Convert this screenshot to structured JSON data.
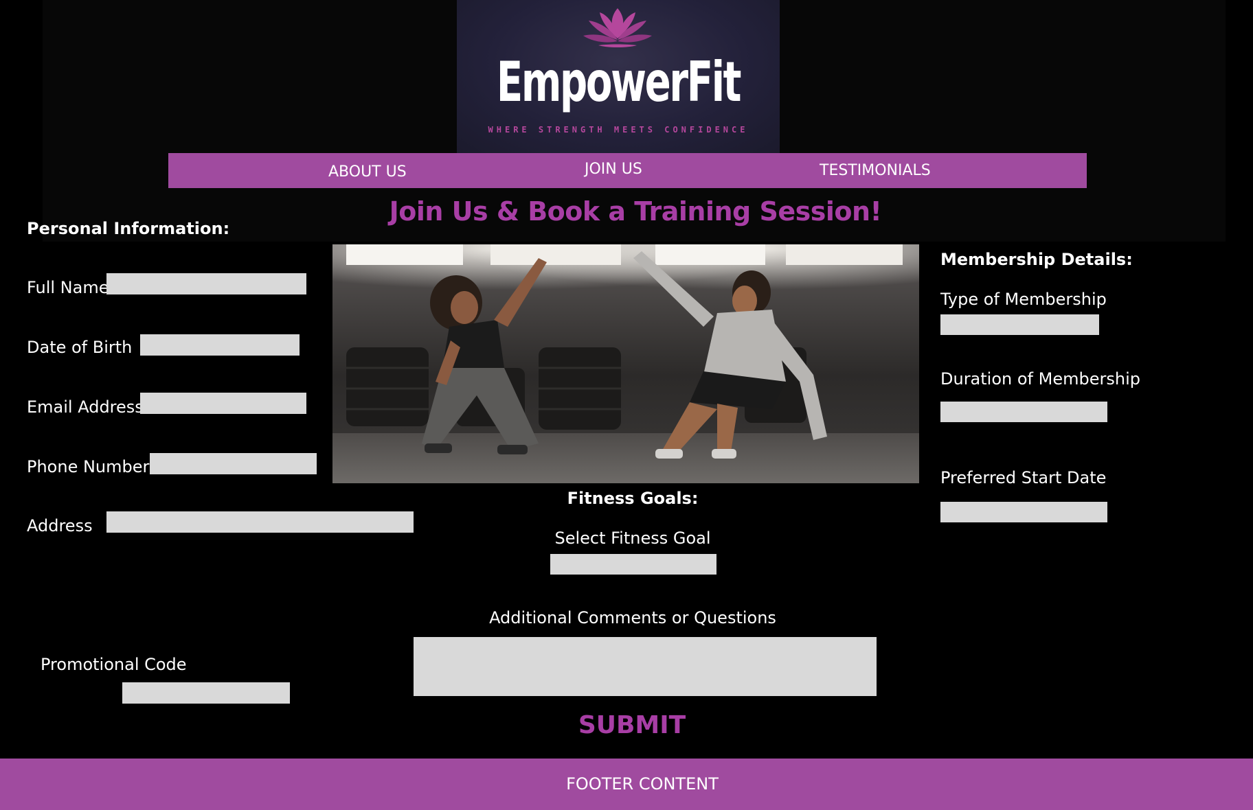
{
  "brand": {
    "name": "EmpowerFit",
    "tagline": "WHERE STRENGTH MEETS CONFIDENCE",
    "accent_color": "#a04b9f",
    "title_color": "#a83ea5",
    "logo_icon": "lotus-icon"
  },
  "nav": {
    "items": [
      {
        "label": "ABOUT US"
      },
      {
        "label": "JOIN US"
      },
      {
        "label": "TESTIMONIALS"
      }
    ]
  },
  "hero": {
    "title": "Join Us & Book a Training Session!"
  },
  "personal": {
    "heading": "Personal Information:",
    "fields": [
      {
        "label": "Full Name",
        "value": ""
      },
      {
        "label": "Date of Birth",
        "value": ""
      },
      {
        "label": "Email Address",
        "value": ""
      },
      {
        "label": "Phone Number",
        "value": ""
      },
      {
        "label": "Address",
        "value": ""
      }
    ]
  },
  "membership": {
    "heading": "Membership Details:",
    "fields": [
      {
        "label": "Type of Membership",
        "value": ""
      },
      {
        "label": "Duration of Membership",
        "value": ""
      },
      {
        "label": "Preferred Start Date",
        "value": ""
      }
    ]
  },
  "fitness": {
    "heading": "Fitness Goals:",
    "goal_label": "Select Fitness Goal",
    "goal_value": "",
    "comments_label": "Additional Comments or Questions",
    "comments_value": ""
  },
  "promo": {
    "label": "Promotional Code",
    "value": ""
  },
  "submit_label": "SUBMIT",
  "footer": {
    "text": "FOOTER CONTENT"
  }
}
